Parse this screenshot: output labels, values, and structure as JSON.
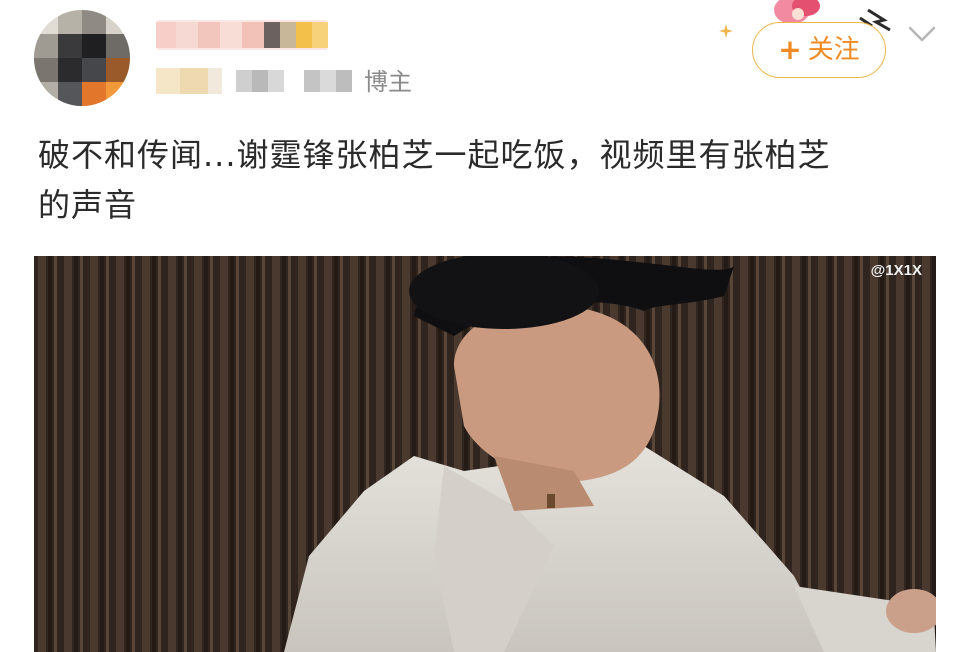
{
  "header": {
    "blogger_label": "博主",
    "follow_button": {
      "plus": "+",
      "label": "关注"
    }
  },
  "post": {
    "text_line1": "破不和传闻...谢霆锋张柏芝一起吃饭，视频里有张柏芝",
    "text_line2": "的声音"
  },
  "media": {
    "watermark": "@1X1X"
  },
  "icons": {
    "chevron": "chevron-down-icon",
    "sparkle": "sparkle-icon"
  },
  "colors": {
    "accent": "#f08a24",
    "accent_border": "#f0b54a",
    "text": "#2b2b2b",
    "muted": "#8a8a8a"
  }
}
